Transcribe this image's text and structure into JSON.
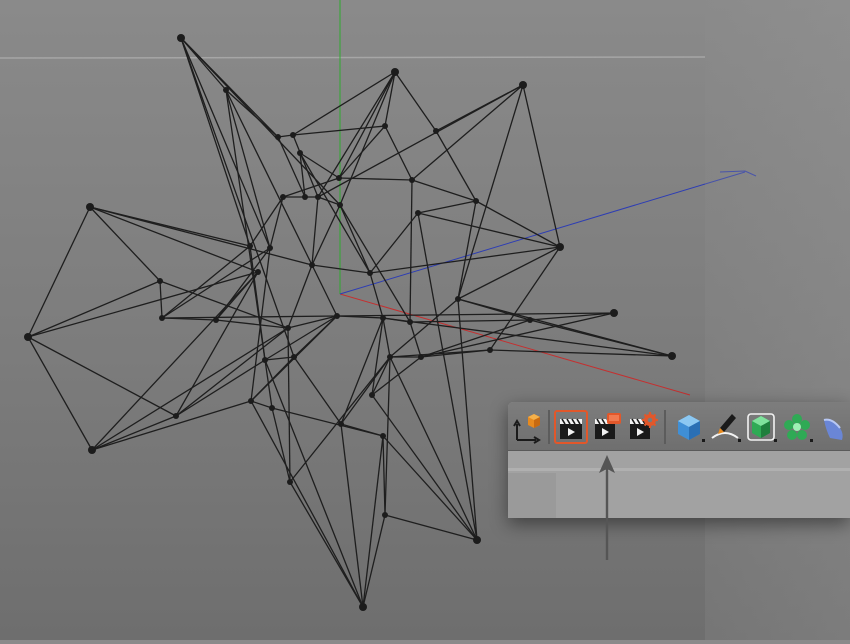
{
  "viewport": {
    "name": "3d-viewport",
    "object": "wireframe-spiky-mesh",
    "axes": {
      "x_color": "#c43030",
      "y_color": "#2faa2f",
      "z_color": "#2d3db4"
    }
  },
  "toolbar": {
    "buttons": [
      {
        "name": "coordinate-system-button",
        "icon": "axis-cube-icon"
      },
      {
        "name": "render-view-button",
        "icon": "clapper-icon",
        "active": true
      },
      {
        "name": "render-to-picture-viewer-button",
        "icon": "clapper-red-icon"
      },
      {
        "name": "render-settings-button",
        "icon": "clapper-gear-icon"
      },
      {
        "name": "cube-button",
        "icon": "cube-icon"
      },
      {
        "name": "pen-spline-button",
        "icon": "pen-icon"
      },
      {
        "name": "subdivision-surface-button",
        "icon": "green-cube-icon"
      },
      {
        "name": "array-button",
        "icon": "flower-icon"
      },
      {
        "name": "deformer-button",
        "icon": "bend-icon"
      }
    ],
    "accent": "#e2572a"
  },
  "annotation": {
    "arrow_color": "#555555",
    "target": "render-view-button"
  }
}
